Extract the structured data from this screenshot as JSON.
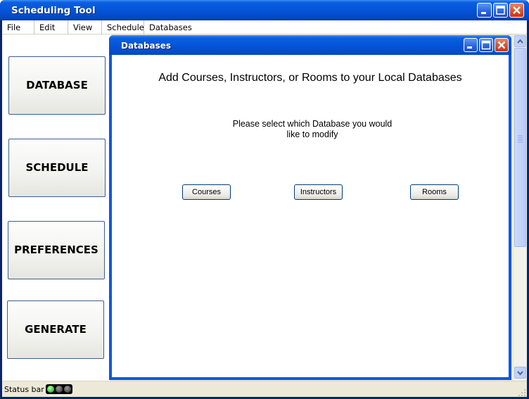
{
  "window": {
    "title": "Scheduling Tool"
  },
  "menu": {
    "items": [
      "File",
      "Edit",
      "View",
      "Schedule",
      "Databases"
    ]
  },
  "sidebar": {
    "buttons": [
      "DATABASE",
      "SCHEDULE",
      "PREFERENCES",
      "GENERATE"
    ]
  },
  "dialog": {
    "title": "Databases",
    "heading": "Add Courses, Instructors, or Rooms to your Local Databases",
    "prompt_line1": "Please select which Database you would",
    "prompt_line2": "like to modify",
    "buttons": [
      "Courses",
      "Instructors",
      "Rooms"
    ]
  },
  "status": {
    "text": "Status bar",
    "lights": [
      "green",
      "off",
      "off"
    ]
  },
  "colors": {
    "titlebar": "#0454d8",
    "accent_border": "#003c74",
    "light_green": "#3cd34a"
  }
}
